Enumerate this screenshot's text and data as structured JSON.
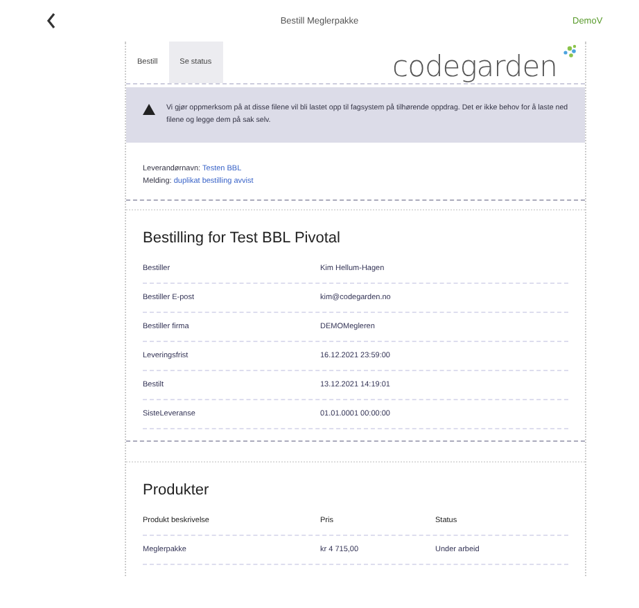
{
  "header": {
    "title": "Bestill Meglerpakke",
    "user": "DemoV"
  },
  "tabs": [
    {
      "label": "Bestill",
      "selected": true
    },
    {
      "label": "Se status",
      "selected": false
    }
  ],
  "logo": {
    "text": "codegarden"
  },
  "warning": {
    "text": "Vi gjør oppmerksom på at disse filene vil bli lastet opp til fagsystem på tilhørende oppdrag. Det er ikke behov for å laste ned filene og legge dem på sak selv."
  },
  "info": [
    {
      "label": "Leverandørnavn:",
      "value": "Testen BBL"
    },
    {
      "label": "Melding:",
      "value": "duplikat bestilling avvist"
    }
  ],
  "order": {
    "title": "Bestilling for Test BBL Pivotal",
    "rows": [
      {
        "label": "Bestiller",
        "value": "Kim Hellum-Hagen"
      },
      {
        "label": "Bestiller E-post",
        "value": "kim@codegarden.no"
      },
      {
        "label": "Bestiller firma",
        "value": "DEMOMegleren"
      },
      {
        "label": "Leveringsfrist",
        "value": "16.12.2021 23:59:00"
      },
      {
        "label": "Bestilt",
        "value": "13.12.2021 14:19:01"
      },
      {
        "label": "SisteLeveranse",
        "value": "01.01.0001 00:00:00"
      }
    ]
  },
  "products": {
    "title": "Produkter",
    "columns": [
      "Produkt beskrivelse",
      "Pris",
      "Status"
    ],
    "rows": [
      [
        "Meglerpakke",
        "kr 4 715,00",
        "Under arbeid"
      ]
    ]
  }
}
